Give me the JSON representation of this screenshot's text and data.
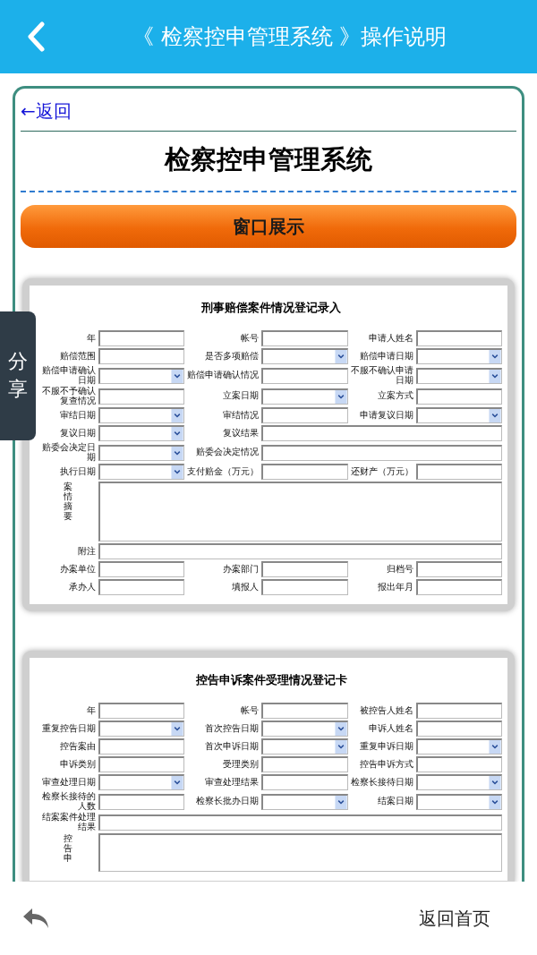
{
  "header": {
    "title": "《 检察控申管理系统 》操作说明"
  },
  "share_tab": {
    "label": "分享"
  },
  "back_link": "←返回",
  "page_title": "检察控申管理系统",
  "section_button": "窗口展示",
  "forms": [
    {
      "title": "刑事赔偿案件情况登记录入",
      "rows": [
        [
          {
            "label": "年",
            "kind": "text"
          },
          {
            "label": "帐号",
            "kind": "text"
          },
          {
            "label": "申请人姓名",
            "kind": "text"
          }
        ],
        [
          {
            "label": "赔偿范围",
            "kind": "text"
          },
          {
            "label": "是否多项赔偿",
            "kind": "select"
          },
          {
            "label": "赔偿申请日期",
            "kind": "select"
          }
        ],
        [
          {
            "label": "赔偿申请确认日期",
            "kind": "select"
          },
          {
            "label": "赔偿申请确认情况",
            "kind": "text"
          },
          {
            "label": "不服不确认申请日期",
            "kind": "select"
          }
        ],
        [
          {
            "label": "不服不予确认复查情况",
            "kind": "text"
          },
          {
            "label": "立案日期",
            "kind": "select"
          },
          {
            "label": "立案方式",
            "kind": "text"
          }
        ],
        [
          {
            "label": "审结日期",
            "kind": "select"
          },
          {
            "label": "审结情况",
            "kind": "text"
          },
          {
            "label": "申请复议日期",
            "kind": "select"
          }
        ],
        [
          {
            "label": "复议日期",
            "kind": "select"
          },
          {
            "label": "复议结果",
            "kind": "wide"
          }
        ],
        [
          {
            "label": "赔委会决定日期",
            "kind": "select"
          },
          {
            "label": "赔委会决定情况",
            "kind": "wide"
          }
        ],
        [
          {
            "label": "执行日期",
            "kind": "select"
          },
          {
            "label": "支付赔金（万元）",
            "kind": "text"
          },
          {
            "label": "还财产（万元）",
            "kind": "text"
          }
        ],
        [
          {
            "label": "案情摘要",
            "kind": "area"
          }
        ],
        [
          {
            "label": "附注",
            "kind": "wide"
          }
        ],
        [
          {
            "label": "办案单位",
            "kind": "text"
          },
          {
            "label": "办案部门",
            "kind": "text"
          },
          {
            "label": "归档号",
            "kind": "text"
          }
        ],
        [
          {
            "label": "承办人",
            "kind": "text"
          },
          {
            "label": "填报人",
            "kind": "text"
          },
          {
            "label": "报出年月",
            "kind": "text"
          }
        ]
      ]
    },
    {
      "title": "控告申诉案件受理情况登记卡",
      "rows": [
        [
          {
            "label": "年",
            "kind": "text"
          },
          {
            "label": "帐号",
            "kind": "text"
          },
          {
            "label": "被控告人姓名",
            "kind": "text"
          }
        ],
        [
          {
            "label": "重复控告日期",
            "kind": "select"
          },
          {
            "label": "首次控告日期",
            "kind": "select"
          },
          {
            "label": "申诉人姓名",
            "kind": "text"
          }
        ],
        [
          {
            "label": "控告案由",
            "kind": "text"
          },
          {
            "label": "首次申诉日期",
            "kind": "select"
          },
          {
            "label": "重复申诉日期",
            "kind": "select"
          }
        ],
        [
          {
            "label": "申诉类别",
            "kind": "text"
          },
          {
            "label": "受理类别",
            "kind": "text"
          },
          {
            "label": "控告申诉方式",
            "kind": "text"
          }
        ],
        [
          {
            "label": "审查处理日期",
            "kind": "select"
          },
          {
            "label": "审查处理结果",
            "kind": "text"
          },
          {
            "label": "检察长接待日期",
            "kind": "select"
          }
        ],
        [
          {
            "label": "检察长接待的人数",
            "kind": "text"
          },
          {
            "label": "检察长批办日期",
            "kind": "select"
          },
          {
            "label": "结案日期",
            "kind": "select"
          }
        ],
        [
          {
            "label": "结案案件处理结果",
            "kind": "wide"
          }
        ],
        [
          {
            "label": "控告申",
            "kind": "area"
          }
        ]
      ]
    }
  ],
  "footer": {
    "home_link": "返回首页"
  }
}
